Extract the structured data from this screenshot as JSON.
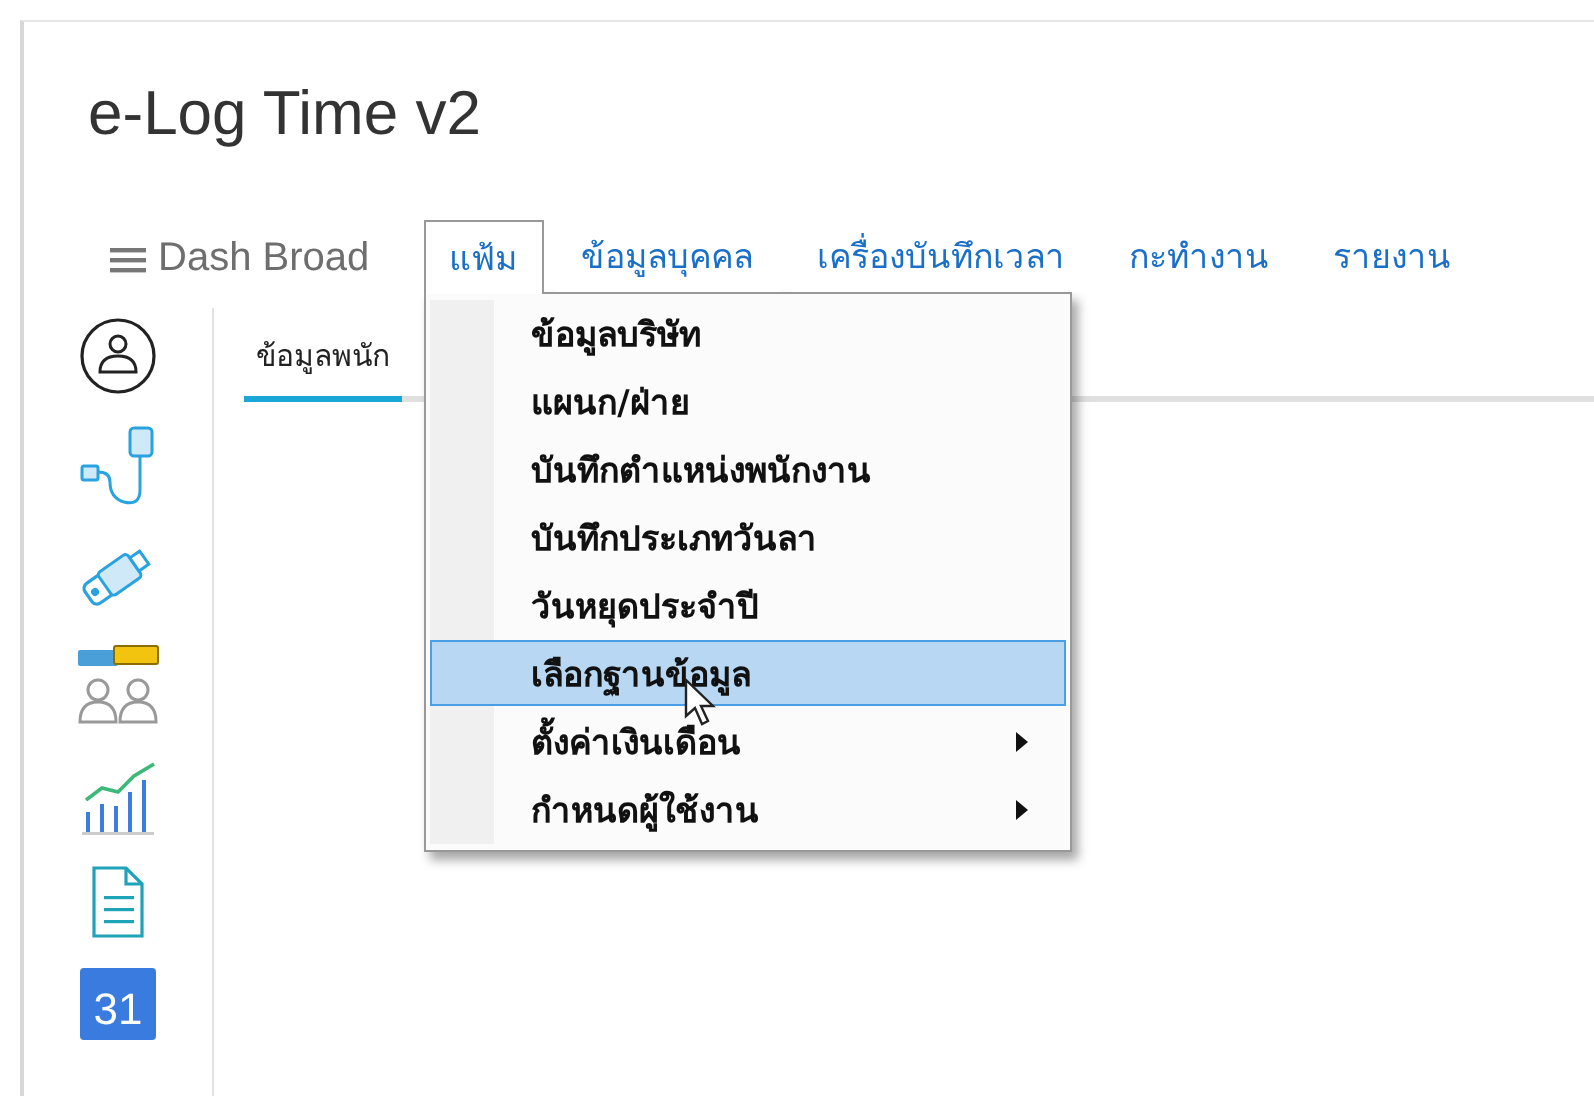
{
  "app": {
    "title": "e-Log Time v2"
  },
  "menu_bar": [
    {
      "label": "Dash Broad",
      "kind": "dashboard",
      "selected": false
    },
    {
      "label": "แฟ้ม",
      "kind": "menu",
      "selected": true
    },
    {
      "label": "ข้อมูลบุคคล",
      "kind": "menu",
      "selected": false
    },
    {
      "label": "เครื่องบันทึกเวลา",
      "kind": "menu",
      "selected": false
    },
    {
      "label": "กะทำงาน",
      "kind": "menu",
      "selected": false
    },
    {
      "label": "รายงาน",
      "kind": "menu",
      "selected": false
    }
  ],
  "tabs": [
    {
      "label": "ข้อมูลพนัก",
      "selected": true
    }
  ],
  "dropdown": {
    "items": [
      {
        "label": "ข้อมูลบริษัท",
        "selected": false,
        "has_submenu": false
      },
      {
        "label": "แผนก/ฝ่าย",
        "selected": false,
        "has_submenu": false
      },
      {
        "label": "บันทึกตำแหน่งพนักงาน",
        "selected": false,
        "has_submenu": false
      },
      {
        "label": "บันทึกประเภทวันลา",
        "selected": false,
        "has_submenu": false
      },
      {
        "label": "วันหยุดประจำปี",
        "selected": false,
        "has_submenu": false
      },
      {
        "label": "เลือกฐานข้อมูล",
        "selected": true,
        "has_submenu": false
      },
      {
        "label": "ตั้งค่าเงินเดือน",
        "selected": false,
        "has_submenu": true
      },
      {
        "label": "กำหนดผู้ใช้งาน",
        "selected": false,
        "has_submenu": true
      }
    ]
  },
  "calendar_icon": {
    "day": "31"
  }
}
